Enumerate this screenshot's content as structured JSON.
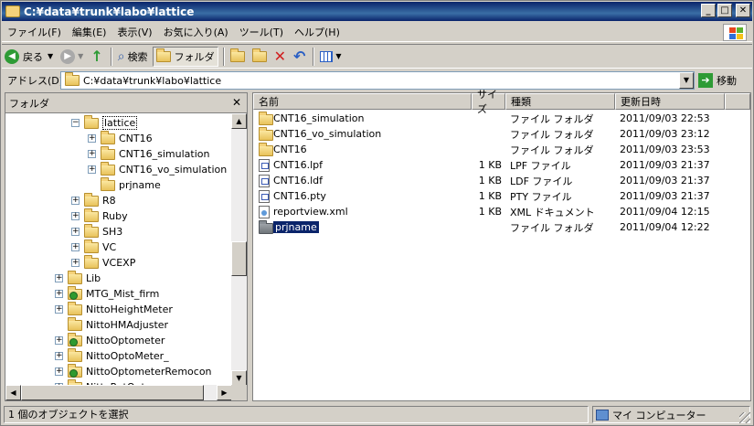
{
  "window": {
    "title": "C:¥data¥trunk¥labo¥lattice"
  },
  "titlebar_buttons": {
    "minimize": "_",
    "maximize": "□",
    "close": "✕"
  },
  "menu": [
    "ファイル(F)",
    "編集(E)",
    "表示(V)",
    "お気に入り(A)",
    "ツール(T)",
    "ヘルプ(H)"
  ],
  "toolbar": {
    "back": "戻る",
    "search": "検索",
    "folders": "フォルダ"
  },
  "address": {
    "label": "アドレス(D)",
    "value": "C:¥data¥trunk¥labo¥lattice",
    "go": "移動"
  },
  "folder_pane": {
    "title": "フォルダ",
    "close": "✕",
    "items": [
      {
        "label": "lattice",
        "indent": 5,
        "expander": "−",
        "selected": true
      },
      {
        "label": "CNT16",
        "indent": 6,
        "expander": "+"
      },
      {
        "label": "CNT16_simulation",
        "indent": 6,
        "expander": "+"
      },
      {
        "label": "CNT16_vo_simulation",
        "indent": 6,
        "expander": "+"
      },
      {
        "label": "prjname",
        "indent": 6,
        "expander": ""
      },
      {
        "label": "R8",
        "indent": 5,
        "expander": "+"
      },
      {
        "label": "Ruby",
        "indent": 5,
        "expander": "+"
      },
      {
        "label": "SH3",
        "indent": 5,
        "expander": "+"
      },
      {
        "label": "VC",
        "indent": 5,
        "expander": "+"
      },
      {
        "label": "VCEXP",
        "indent": 5,
        "expander": "+"
      },
      {
        "label": "Lib",
        "indent": 4,
        "expander": "+"
      },
      {
        "label": "MTG_Mist_firm",
        "indent": 4,
        "expander": "+",
        "icon": "cd"
      },
      {
        "label": "NittoHeightMeter",
        "indent": 4,
        "expander": "+"
      },
      {
        "label": "NittoHMAdjuster",
        "indent": 4,
        "expander": ""
      },
      {
        "label": "NittoOptometer",
        "indent": 4,
        "expander": "+",
        "icon": "cd"
      },
      {
        "label": "NittoOptoMeter_",
        "indent": 4,
        "expander": "+"
      },
      {
        "label": "NittoOptometerRemocon",
        "indent": 4,
        "expander": "+",
        "icon": "cd"
      },
      {
        "label": "NittoRotOpt",
        "indent": 4,
        "expander": "+"
      }
    ]
  },
  "file_list": {
    "columns": {
      "name": "名前",
      "size": "サイズ",
      "type": "種類",
      "modified": "更新日時"
    },
    "rows": [
      {
        "name": "CNT16_simulation",
        "size": "",
        "type": "ファイル フォルダ",
        "modified": "2011/09/03 22:53",
        "icon": "folder"
      },
      {
        "name": "CNT16_vo_simulation",
        "size": "",
        "type": "ファイル フォルダ",
        "modified": "2011/09/03 23:12",
        "icon": "folder"
      },
      {
        "name": "CNT16",
        "size": "",
        "type": "ファイル フォルダ",
        "modified": "2011/09/03 23:53",
        "icon": "folder"
      },
      {
        "name": "CNT16.lpf",
        "size": "1 KB",
        "type": "LPF ファイル",
        "modified": "2011/09/03 21:37",
        "icon": "file"
      },
      {
        "name": "CNT16.ldf",
        "size": "1 KB",
        "type": "LDF ファイル",
        "modified": "2011/09/03 21:37",
        "icon": "file"
      },
      {
        "name": "CNT16.pty",
        "size": "1 KB",
        "type": "PTY ファイル",
        "modified": "2011/09/03 21:37",
        "icon": "file"
      },
      {
        "name": "reportview.xml",
        "size": "1 KB",
        "type": "XML ドキュメント",
        "modified": "2011/09/04 12:15",
        "icon": "xml"
      },
      {
        "name": "prjname",
        "size": "",
        "type": "ファイル フォルダ",
        "modified": "2011/09/04 12:22",
        "icon": "folder-gray",
        "selected": true
      }
    ]
  },
  "status": {
    "left": "1 個のオブジェクトを選択",
    "right": "マイ コンピューター"
  }
}
